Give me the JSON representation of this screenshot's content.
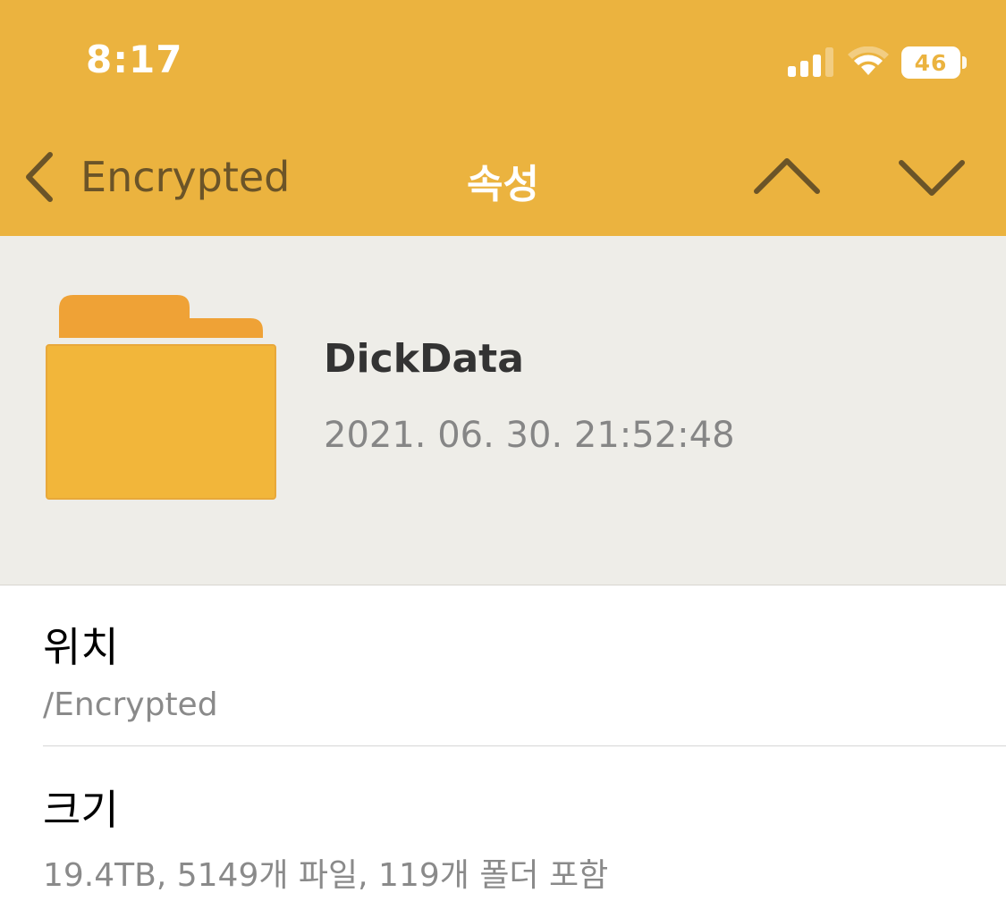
{
  "status_bar": {
    "time": "8:17",
    "battery_level": "46",
    "icons": [
      "cellular-signal-icon",
      "wifi-icon",
      "battery-icon"
    ]
  },
  "nav": {
    "back_label": "Encrypted",
    "title": "속성",
    "icons": [
      "chevron-left-icon",
      "chevron-up-icon",
      "chevron-down-icon"
    ]
  },
  "file": {
    "icon": "folder-icon",
    "name": "DickData",
    "date": "2021. 06. 30. 21:52:48"
  },
  "properties": [
    {
      "label": "위치",
      "value": "/Encrypted"
    },
    {
      "label": "크기",
      "value": "19.4TB, 5149개 파일, 119개 폴더 포함"
    }
  ],
  "colors": {
    "header_bg": "#EBB33F",
    "nav_accent": "#6B5428",
    "summary_bg": "#EEEDE8",
    "folder_tab": "#EFA236",
    "folder_body": "#F2B63A"
  }
}
